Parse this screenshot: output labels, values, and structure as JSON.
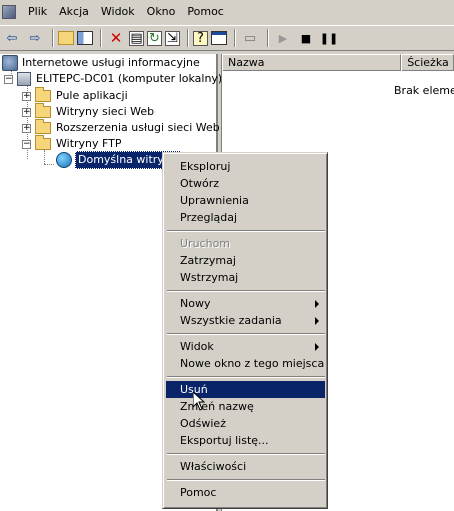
{
  "menubar": {
    "items": [
      "Plik",
      "Akcja",
      "Widok",
      "Okno",
      "Pomoc"
    ]
  },
  "toolbar": {
    "icons": [
      "back-icon",
      "forward-icon",
      "up-folder-icon",
      "show-tree-icon",
      "delete-icon",
      "properties-icon",
      "refresh-icon",
      "export-icon",
      "help-icon",
      "new-window-icon",
      "computer-icon",
      "play-icon",
      "stop-icon",
      "pause-icon"
    ]
  },
  "tree": {
    "root": "Internetowe usługi informacyjne",
    "server": "ELITEPC-DC01 (komputer lokalny)",
    "children": [
      "Pule aplikacji",
      "Witryny sieci Web",
      "Rozszerzenia usługi sieci Web",
      "Witryny FTP"
    ],
    "selected": "Domyślna witryna"
  },
  "list": {
    "columns": [
      "Nazwa",
      "Ścieżka"
    ],
    "empty_message": "Brak element"
  },
  "context_menu": {
    "items": [
      {
        "label": "Eksploruj",
        "state": "normal"
      },
      {
        "label": "Otwórz",
        "state": "normal"
      },
      {
        "label": "Uprawnienia",
        "state": "normal"
      },
      {
        "label": "Przeglądaj",
        "state": "normal"
      },
      {
        "label": "Uruchom",
        "state": "disabled"
      },
      {
        "label": "Zatrzymaj",
        "state": "normal"
      },
      {
        "label": "Wstrzymaj",
        "state": "normal"
      },
      {
        "label": "Nowy",
        "state": "submenu"
      },
      {
        "label": "Wszystkie zadania",
        "state": "submenu"
      },
      {
        "label": "Widok",
        "state": "submenu"
      },
      {
        "label": "Nowe okno z tego miejsca",
        "state": "normal"
      },
      {
        "label": "Usuń",
        "state": "highlight"
      },
      {
        "label": "Zmień nazwę",
        "state": "normal"
      },
      {
        "label": "Odśwież",
        "state": "normal"
      },
      {
        "label": "Eksportuj listę...",
        "state": "normal"
      },
      {
        "label": "Właściwości",
        "state": "normal"
      },
      {
        "label": "Pomoc",
        "state": "normal"
      }
    ]
  },
  "colors": {
    "chrome": "#d4d0c8",
    "highlight": "#0a246a",
    "disabled": "#808080"
  }
}
